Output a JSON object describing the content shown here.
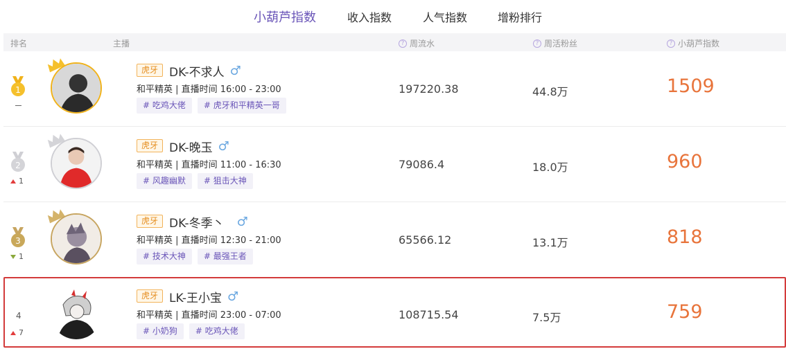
{
  "tabs": [
    {
      "label": "小葫芦指数",
      "active": true
    },
    {
      "label": "收入指数",
      "active": false
    },
    {
      "label": "人气指数",
      "active": false
    },
    {
      "label": "增粉排行",
      "active": false
    }
  ],
  "columns": {
    "rank": "排名",
    "anchor": "主播",
    "weekly_flow": "周流水",
    "weekly_fans": "周活粉丝",
    "index": "小葫芦指数"
  },
  "rows": [
    {
      "rank": "1",
      "medal": "gold",
      "change": "—",
      "change_dir": "none",
      "platform": "虎牙",
      "name": "DK-不求人",
      "game_time": "和平精英 | 直播时间 16:00 - 23:00",
      "tags": [
        "# 吃鸡大佬",
        "# 虎牙和平精英一哥"
      ],
      "weekly_flow": "197220.38",
      "weekly_fans": "44.8万",
      "index": "1509",
      "highlighted": false
    },
    {
      "rank": "2",
      "medal": "silver",
      "change": "1",
      "change_dir": "up",
      "platform": "虎牙",
      "name": "DK-晚玉",
      "game_time": "和平精英 | 直播时间 11:00 - 16:30",
      "tags": [
        "# 风趣幽默",
        "# 狙击大神"
      ],
      "weekly_flow": "79086.4",
      "weekly_fans": "18.0万",
      "index": "960",
      "highlighted": false
    },
    {
      "rank": "3",
      "medal": "bronze",
      "change": "1",
      "change_dir": "down",
      "platform": "虎牙",
      "name": "DK-冬季丶",
      "game_time": "和平精英 | 直播时间 12:30 - 21:00",
      "tags": [
        "# 技术大神",
        "# 最强王者"
      ],
      "weekly_flow": "65566.12",
      "weekly_fans": "13.1万",
      "index": "818",
      "highlighted": false
    },
    {
      "rank": "4",
      "medal": "none",
      "change": "7",
      "change_dir": "up",
      "platform": "虎牙",
      "name": "LK-王小宝",
      "game_time": "和平精英 | 直播时间 23:00 - 07:00",
      "tags": [
        "# 小奶狗",
        "# 吃鸡大佬"
      ],
      "weekly_flow": "108715.54",
      "weekly_fans": "7.5万",
      "index": "759",
      "highlighted": true
    }
  ],
  "icons": {
    "gender": "male-icon",
    "help": "question-icon",
    "crown": "crown-icon",
    "medal": "medal-icon"
  },
  "colors": {
    "accent": "#6a55b8",
    "index": "#e8743b",
    "gold": "#f0b21a",
    "silver": "#cfcfd4",
    "bronze": "#c7a560",
    "highlight_border": "#d33a3a",
    "up": "#e23c3c",
    "down": "#8aa83a"
  }
}
